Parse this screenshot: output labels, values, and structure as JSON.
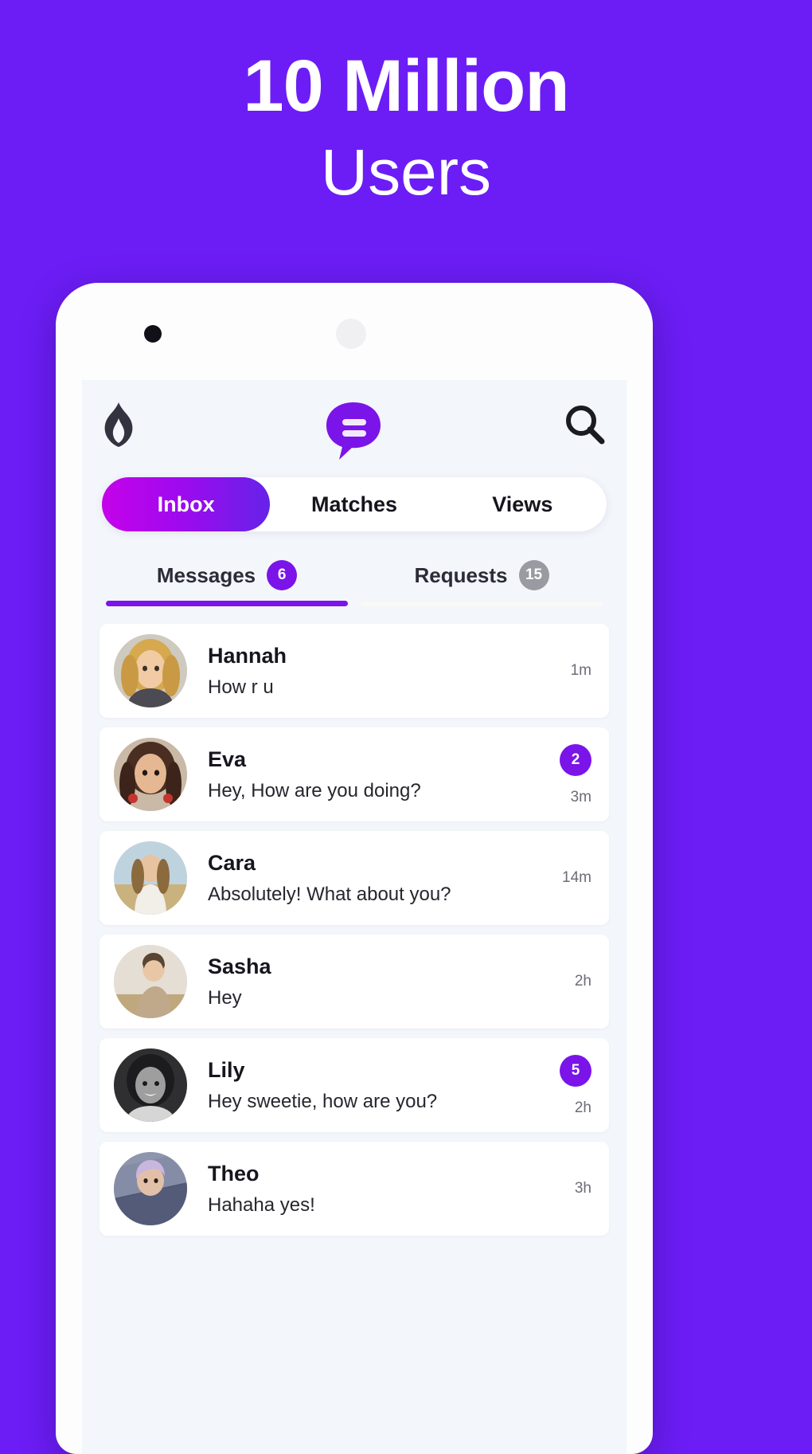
{
  "promo": {
    "headline_bold": "10 Million",
    "headline_light": "Users"
  },
  "app": {
    "header": {
      "flame_icon": "flame-icon",
      "chat_icon": "chat-bubble-icon",
      "search_icon": "search-icon"
    },
    "segments": [
      {
        "label": "Inbox",
        "active": true
      },
      {
        "label": "Matches",
        "active": false
      },
      {
        "label": "Views",
        "active": false
      }
    ],
    "subtabs": [
      {
        "label": "Messages",
        "badge": "6",
        "badge_color": "#7B14E8",
        "active": true
      },
      {
        "label": "Requests",
        "badge": "15",
        "badge_color": "#9A9AA2",
        "active": false
      }
    ],
    "messages": [
      {
        "name": "Hannah",
        "preview": "How r u",
        "time": "1m",
        "badge": ""
      },
      {
        "name": "Eva",
        "preview": "Hey, How are you doing?",
        "time": "3m",
        "badge": "2"
      },
      {
        "name": "Cara",
        "preview": "Absolutely! What about you?",
        "time": "14m",
        "badge": ""
      },
      {
        "name": "Sasha",
        "preview": "Hey",
        "time": "2h",
        "badge": ""
      },
      {
        "name": "Lily",
        "preview": "Hey sweetie, how are you?",
        "time": "2h",
        "badge": "5"
      },
      {
        "name": "Theo",
        "preview": "Hahaha yes!",
        "time": "3h",
        "badge": ""
      }
    ]
  },
  "colors": {
    "background": "#6C1DF5",
    "accent": "#7B14E8",
    "pill_gradient_start": "#C502EA",
    "pill_gradient_end": "#6622E8",
    "screen_bg": "#F3F6FA"
  }
}
